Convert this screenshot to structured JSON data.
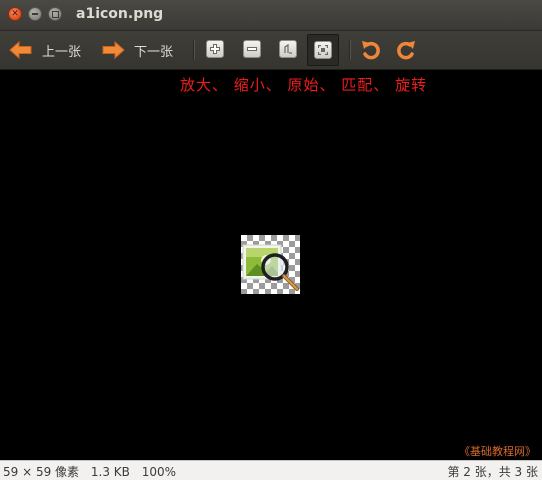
{
  "window": {
    "title": "a1icon.png"
  },
  "toolbar": {
    "prev_label": "上一张",
    "next_label": "下一张",
    "buttons": {
      "zoom_in": "zoom-in-icon",
      "zoom_out": "zoom-out-icon",
      "original_size": "original-size-icon",
      "fit": "fit-icon",
      "rotate_left": "rotate-left-icon",
      "rotate_right": "rotate-right-icon"
    }
  },
  "annotation": {
    "text": "放大、 缩小、 原始、 匹配、 旋转",
    "color": "#ee1c1c"
  },
  "watermark": {
    "text": "《基础教程网》"
  },
  "statusbar": {
    "dimensions": "59 × 59 像素",
    "file_size": "1.3 KB",
    "zoom": "100%",
    "position": "第 2 张，共 3 张"
  },
  "colors": {
    "accent_orange": "#f08a3b",
    "titlebar": "#3c3b37",
    "canvas": "#000000"
  }
}
